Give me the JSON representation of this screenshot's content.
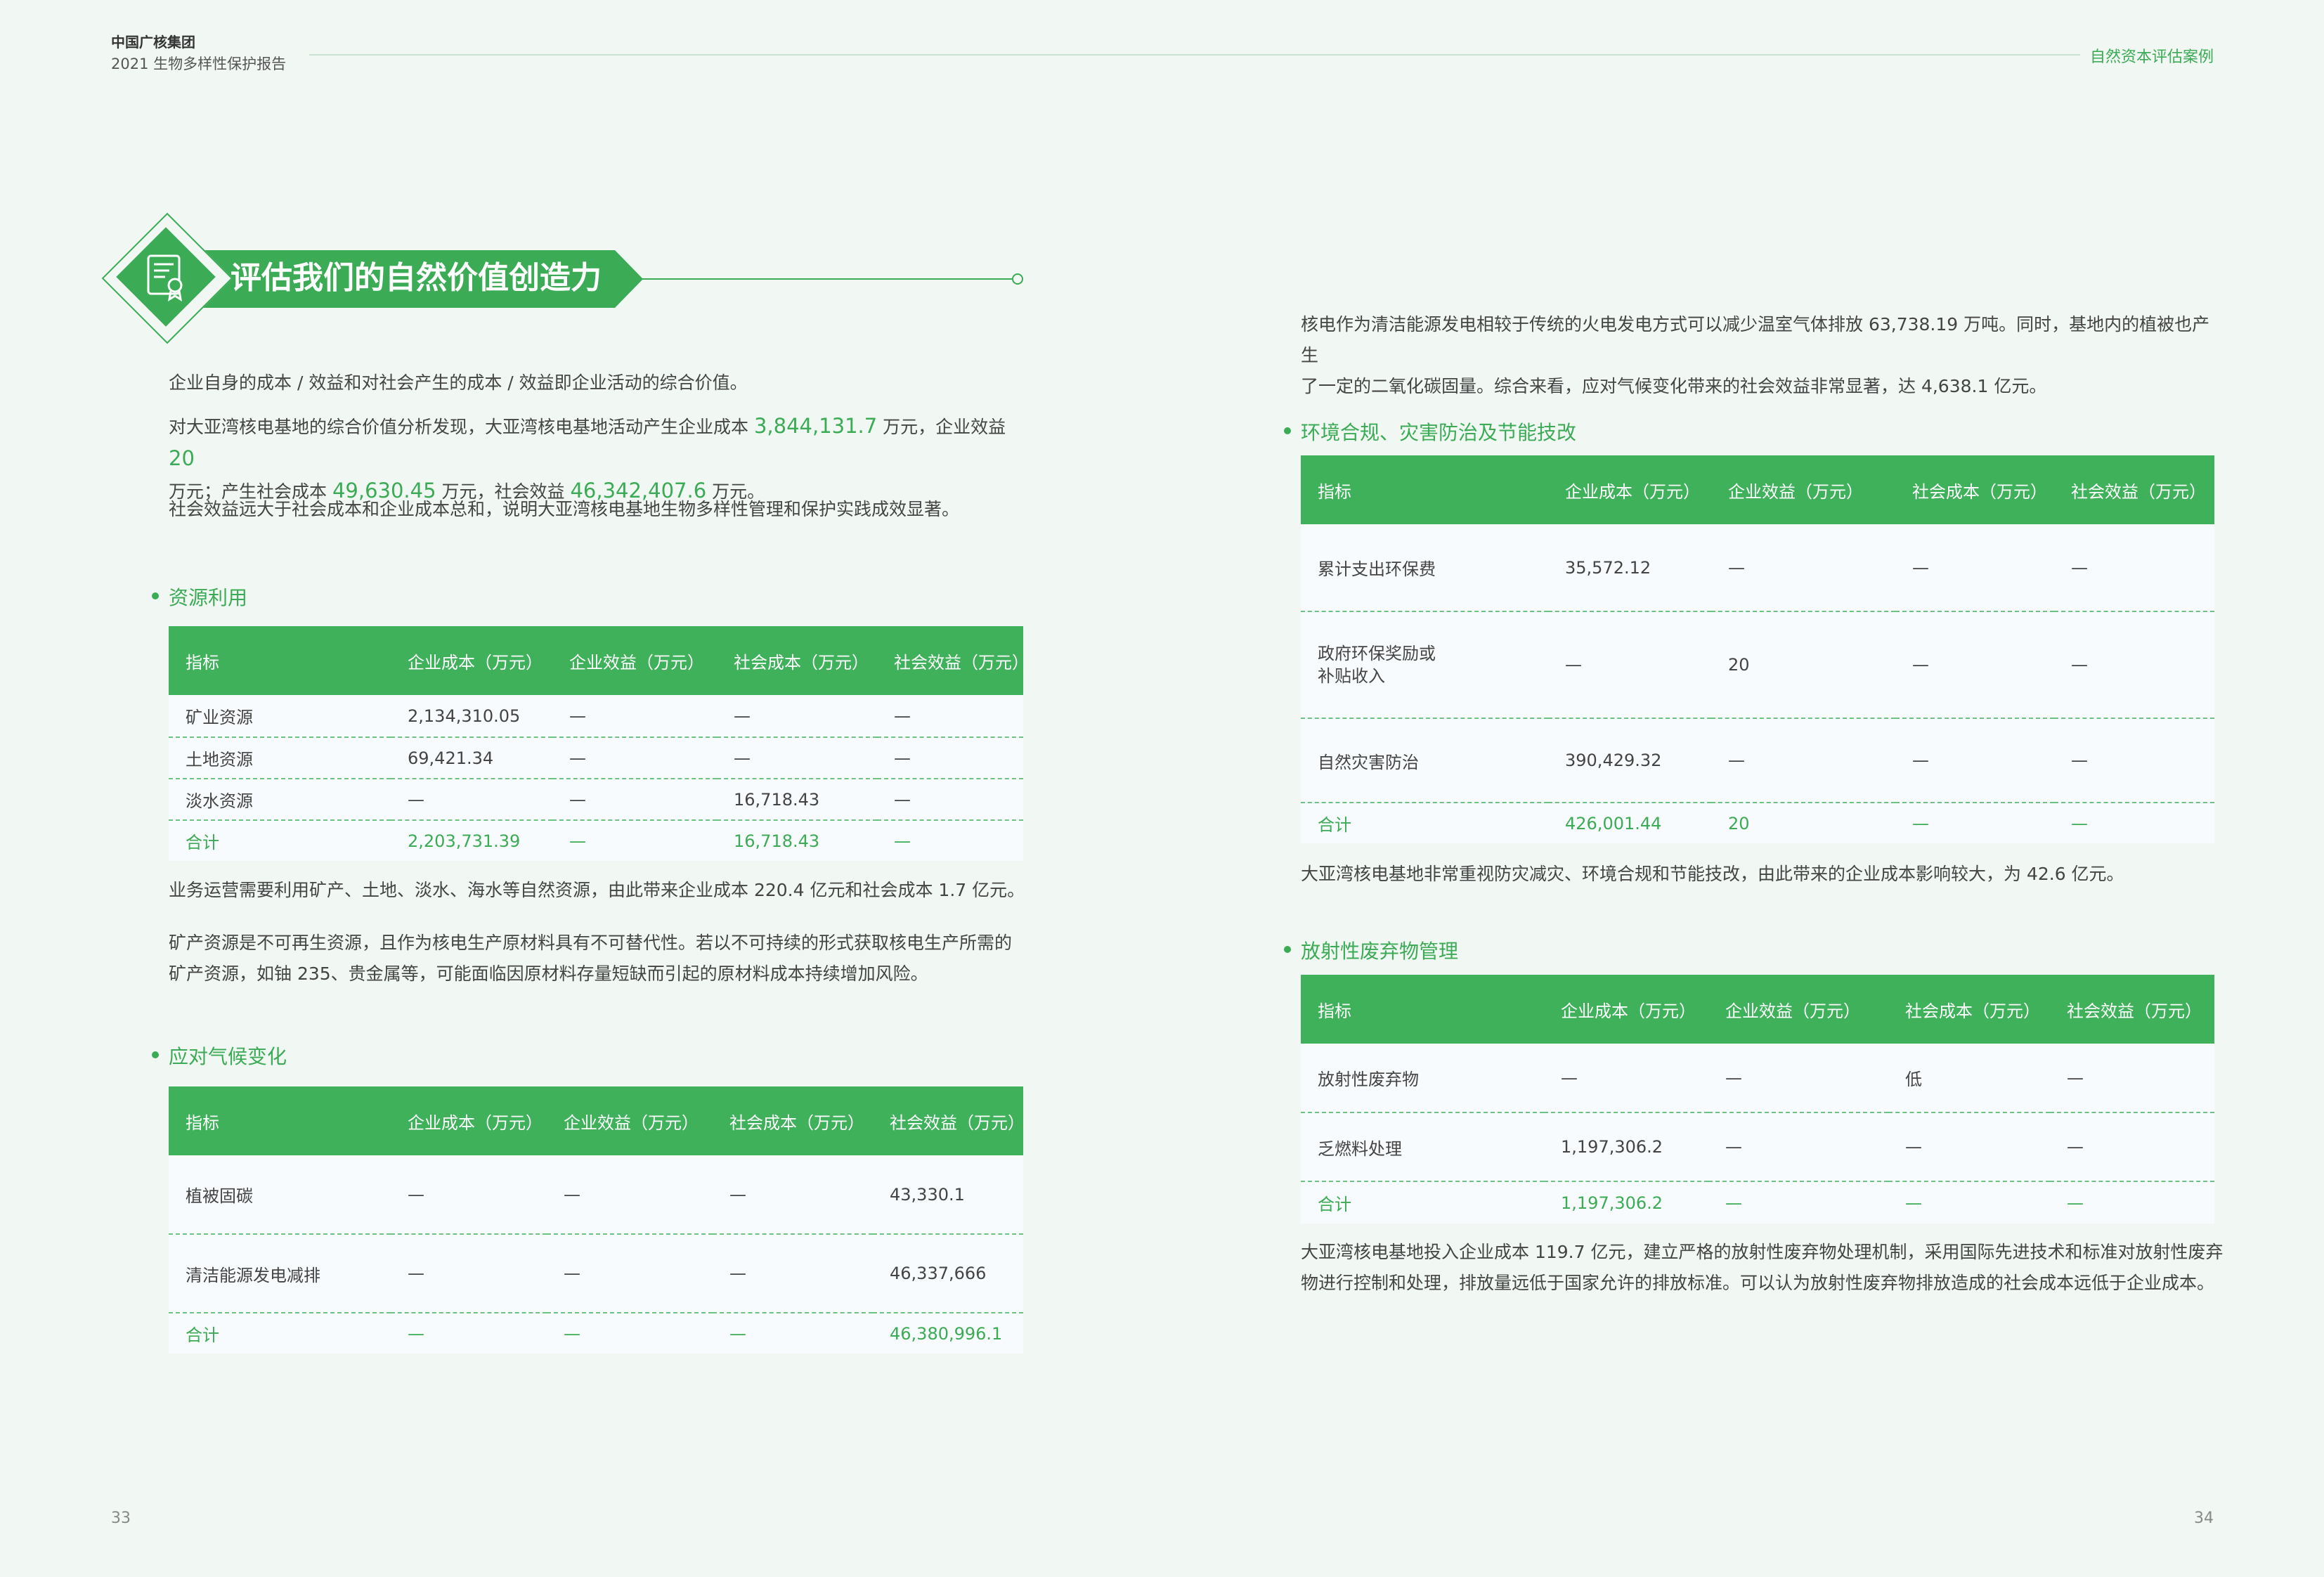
{
  "header": {
    "company": "中国广核集团",
    "report": "2021 生物多样性保护报告",
    "section": "自然资本评估案例"
  },
  "title": "评估我们的自然价值创造力",
  "icon": "certificate-icon",
  "intro": {
    "p1": "企业自身的成本 / 效益和对社会产生的成本 / 效益即企业活动的综合价值。",
    "p2a": "对大亚湾核电基地的综合价值分析发现，大亚湾核电基地活动产生企业成本 ",
    "p2v1": "3,844,131.7",
    "p2b": " 万元，企业效益 ",
    "p2v2": "20",
    "p2c": "万元；产生社会成本 ",
    "p2v3": "49,630.45",
    "p2d": " 万元，社会效益 ",
    "p2v4": "46,342,407.6",
    "p2e": " 万元。",
    "p3": "社会效益远大于社会成本和企业成本总和，说明大亚湾核电基地生物多样性管理和保护实践成效显著。"
  },
  "columns": [
    "指标",
    "企业成本（万元）",
    "企业效益（万元）",
    "社会成本（万元）",
    "社会效益（万元）"
  ],
  "resources": {
    "heading": "资源利用",
    "rows": [
      [
        "矿业资源",
        "2,134,310.05",
        "—",
        "—",
        "—"
      ],
      [
        "土地资源",
        "69,421.34",
        "—",
        "—",
        "—"
      ],
      [
        "淡水资源",
        "—",
        "—",
        "16,718.43",
        "—"
      ]
    ],
    "total": [
      "合计",
      "2,203,731.39",
      "—",
      "16,718.43",
      "—"
    ],
    "note1": "业务运营需要利用矿产、土地、淡水、海水等自然资源，由此带来企业成本 220.4 亿元和社会成本 1.7 亿元。",
    "note2a": "矿产资源是不可再生资源，且作为核电生产原材料具有不可替代性。若以不可持续的形式获取核电生产所需的",
    "note2b": "矿产资源，如铀 235、贵金属等，可能面临因原材料存量短缺而引起的原材料成本持续增加风险。"
  },
  "climate": {
    "heading": "应对气候变化",
    "rows": [
      [
        "植被固碳",
        "—",
        "—",
        "—",
        "43,330.1"
      ],
      [
        "清洁能源发电减排",
        "—",
        "—",
        "—",
        "46,337,666"
      ]
    ],
    "total": [
      "合计",
      "—",
      "—",
      "—",
      "46,380,996.1"
    ]
  },
  "right_intro": {
    "l1": "核电作为清洁能源发电相较于传统的火电发电方式可以减少温室气体排放 63,738.19 万吨。同时，基地内的植被也产生",
    "l2": "了一定的二氧化碳固量。综合来看，应对气候变化带来的社会效益非常显著，达 4,638.1 亿元。"
  },
  "environment": {
    "heading": "环境合规、灾害防治及节能技改",
    "rows": [
      [
        "累计支出环保费",
        "35,572.12",
        "—",
        "—",
        "—"
      ],
      [
        "政府环保奖励或补贴收入",
        "—",
        "20",
        "—",
        "—"
      ],
      [
        "自然灾害防治",
        "390,429.32",
        "—",
        "—",
        "—"
      ]
    ],
    "row2_l1": "政府环保奖励或",
    "row2_l2": "补贴收入",
    "total": [
      "合计",
      "426,001.44",
      "20",
      "—",
      "—"
    ],
    "note": "大亚湾核电基地非常重视防灾减灾、环境合规和节能技改，由此带来的企业成本影响较大，为 42.6 亿元。"
  },
  "waste": {
    "heading": "放射性废弃物管理",
    "rows": [
      [
        "放射性废弃物",
        "—",
        "—",
        "低",
        "—"
      ],
      [
        "乏燃料处理",
        "1,197,306.2",
        "—",
        "—",
        "—"
      ]
    ],
    "total": [
      "合计",
      "1,197,306.2",
      "—",
      "—",
      "—"
    ],
    "note_l1": "大亚湾核电基地投入企业成本 119.7 亿元，建立严格的放射性废弃物处理机制，采用国际先进技术和标准对放射性废弃",
    "note_l2": "物进行控制和处理，排放量远低于国家允许的排放标准。可以认为放射性废弃物排放造成的社会成本远低于企业成本。"
  },
  "pages": {
    "left": "33",
    "right": "34"
  }
}
